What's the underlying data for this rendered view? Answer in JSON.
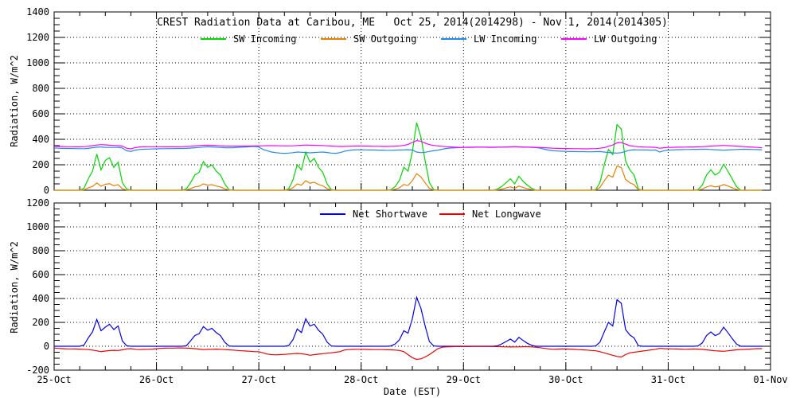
{
  "title": "CREST Radiation Data at Caribou, ME   Oct 25, 2014(2014298) - Nov 1, 2014(2014305)",
  "xlabel": "Date (EST)",
  "x_day_labels": [
    "25-Oct",
    "26-Oct",
    "27-Oct",
    "28-Oct",
    "29-Oct",
    "30-Oct",
    "31-Oct",
    "01-Nov"
  ],
  "chart_data": [
    {
      "type": "line",
      "title": "CREST Radiation Data at Caribou, ME   Oct 25, 2014(2014298) - Nov 1, 2014(2014305)",
      "ylabel": "Radiation, W/m^2",
      "xlabel": "Date (EST)",
      "ylim": [
        0,
        1400
      ],
      "ytick_step": 200,
      "ytick_minor_step": 50,
      "x_minor_step_hours": 6,
      "grid": true,
      "legend_position": "top-inside",
      "x_unit": "hours since Oct 25 00:00 EST, one value per hour",
      "series": [
        {
          "name": "SW Incoming",
          "color": "#00d800",
          "values": [
            0,
            0,
            0,
            0,
            0,
            0,
            0,
            15,
            90,
            150,
            285,
            160,
            235,
            255,
            180,
            220,
            60,
            10,
            0,
            0,
            0,
            0,
            0,
            0,
            0,
            0,
            0,
            0,
            0,
            0,
            0,
            10,
            60,
            120,
            140,
            225,
            180,
            200,
            150,
            120,
            50,
            5,
            0,
            0,
            0,
            0,
            0,
            0,
            0,
            0,
            0,
            0,
            0,
            0,
            0,
            10,
            80,
            200,
            160,
            300,
            220,
            250,
            180,
            140,
            50,
            5,
            0,
            0,
            0,
            0,
            0,
            0,
            0,
            0,
            0,
            0,
            0,
            0,
            0,
            5,
            30,
            80,
            180,
            150,
            300,
            530,
            420,
            230,
            60,
            5,
            0,
            0,
            0,
            0,
            0,
            0,
            0,
            0,
            0,
            0,
            0,
            0,
            0,
            0,
            10,
            30,
            60,
            90,
            50,
            110,
            70,
            40,
            15,
            0,
            0,
            0,
            0,
            0,
            0,
            0,
            0,
            0,
            0,
            0,
            0,
            0,
            0,
            5,
            60,
            200,
            320,
            280,
            515,
            480,
            230,
            160,
            120,
            10,
            0,
            0,
            0,
            0,
            0,
            0,
            0,
            0,
            0,
            0,
            0,
            0,
            0,
            5,
            40,
            120,
            160,
            120,
            140,
            205,
            150,
            90,
            30,
            0,
            0,
            0,
            0,
            0,
            0
          ]
        },
        {
          "name": "SW Outgoing",
          "color": "#e88000",
          "values": [
            0,
            0,
            0,
            0,
            0,
            0,
            0,
            3,
            18,
            30,
            57,
            32,
            47,
            51,
            36,
            44,
            12,
            2,
            0,
            0,
            0,
            0,
            0,
            0,
            0,
            0,
            0,
            0,
            0,
            0,
            0,
            2,
            13,
            26,
            31,
            50,
            40,
            44,
            33,
            26,
            11,
            1,
            0,
            0,
            0,
            0,
            0,
            0,
            0,
            0,
            0,
            0,
            0,
            0,
            0,
            3,
            20,
            50,
            40,
            75,
            55,
            63,
            45,
            35,
            13,
            1,
            0,
            0,
            0,
            0,
            0,
            0,
            0,
            0,
            0,
            0,
            0,
            0,
            0,
            1,
            8,
            20,
            45,
            38,
            75,
            130,
            105,
            58,
            15,
            1,
            0,
            0,
            0,
            0,
            0,
            0,
            0,
            0,
            0,
            0,
            0,
            0,
            0,
            0,
            3,
            9,
            18,
            27,
            15,
            33,
            21,
            12,
            5,
            0,
            0,
            0,
            0,
            0,
            0,
            0,
            0,
            0,
            0,
            0,
            0,
            0,
            0,
            2,
            22,
            74,
            118,
            104,
            190,
            178,
            85,
            59,
            44,
            4,
            0,
            0,
            0,
            0,
            0,
            0,
            0,
            0,
            0,
            0,
            0,
            0,
            0,
            1,
            9,
            26,
            35,
            26,
            31,
            45,
            33,
            20,
            7,
            0,
            0,
            0,
            0,
            0,
            0
          ]
        },
        {
          "name": "LW Incoming",
          "color": "#1e8cec",
          "values": [
            332,
            330,
            329,
            328,
            328,
            327,
            326,
            326,
            329,
            334,
            338,
            340,
            337,
            336,
            336,
            337,
            332,
            310,
            305,
            315,
            320,
            322,
            323,
            324,
            325,
            326,
            326,
            327,
            327,
            328,
            328,
            329,
            331,
            334,
            337,
            339,
            341,
            340,
            338,
            336,
            334,
            333,
            334,
            336,
            338,
            340,
            342,
            344,
            340,
            320,
            310,
            300,
            295,
            292,
            290,
            292,
            295,
            300,
            298,
            296,
            294,
            296,
            298,
            300,
            296,
            292,
            290,
            295,
            305,
            312,
            316,
            318,
            318,
            317,
            316,
            316,
            315,
            315,
            314,
            314,
            315,
            316,
            317,
            318,
            316,
            300,
            295,
            298,
            305,
            310,
            315,
            322,
            328,
            332,
            334,
            335,
            336,
            337,
            337,
            338,
            338,
            338,
            337,
            337,
            338,
            338,
            339,
            340,
            341,
            341,
            340,
            339,
            337,
            335,
            330,
            322,
            315,
            310,
            308,
            306,
            305,
            304,
            304,
            303,
            303,
            302,
            302,
            303,
            304,
            300,
            296,
            294,
            292,
            295,
            305,
            315,
            318,
            317,
            316,
            316,
            315,
            316,
            300,
            310,
            315,
            317,
            318,
            319,
            320,
            320,
            321,
            321,
            322,
            322,
            320,
            318,
            316,
            315,
            316,
            318,
            320,
            321,
            322,
            321,
            320,
            319,
            318
          ]
        },
        {
          "name": "LW Outgoing",
          "color": "#ff00ff",
          "values": [
            345,
            344,
            343,
            342,
            342,
            341,
            341,
            342,
            345,
            350,
            355,
            358,
            356,
            354,
            352,
            350,
            346,
            330,
            325,
            335,
            340,
            341,
            342,
            342,
            342,
            342,
            341,
            341,
            341,
            341,
            342,
            343,
            345,
            348,
            351,
            353,
            354,
            353,
            351,
            349,
            347,
            346,
            346,
            346,
            346,
            346,
            347,
            348,
            348,
            349,
            350,
            350,
            350,
            349,
            348,
            348,
            349,
            351,
            353,
            355,
            354,
            353,
            352,
            351,
            349,
            347,
            345,
            344,
            344,
            345,
            346,
            347,
            347,
            346,
            346,
            345,
            345,
            344,
            344,
            345,
            346,
            348,
            352,
            360,
            375,
            390,
            385,
            370,
            358,
            352,
            348,
            345,
            342,
            340,
            338,
            337,
            337,
            338,
            338,
            338,
            338,
            338,
            338,
            338,
            338,
            339,
            340,
            341,
            341,
            340,
            339,
            338,
            338,
            337,
            336,
            334,
            332,
            330,
            329,
            328,
            328,
            327,
            326,
            326,
            325,
            325,
            326,
            327,
            330,
            335,
            345,
            355,
            372,
            375,
            362,
            350,
            345,
            342,
            340,
            339,
            338,
            337,
            330,
            334,
            336,
            337,
            338,
            338,
            339,
            340,
            340,
            341,
            342,
            344,
            346,
            348,
            350,
            352,
            350,
            348,
            346,
            344,
            342,
            340,
            338,
            336,
            334
          ]
        }
      ]
    },
    {
      "type": "line",
      "ylabel": "Radiation, W/m^2",
      "xlabel": "Date (EST)",
      "ylim": [
        -200,
        1200
      ],
      "ytick_step": 200,
      "ytick_minor_step": 50,
      "x_minor_step_hours": 6,
      "grid": true,
      "legend_position": "top-inside",
      "x_unit": "hours since Oct 25 00:00 EST, one value per hour",
      "series": [
        {
          "name": "Net Shortwave",
          "color": "#0000ee",
          "values": [
            0,
            0,
            0,
            0,
            0,
            0,
            0,
            10,
            70,
            120,
            225,
            130,
            160,
            185,
            140,
            170,
            45,
            5,
            0,
            0,
            0,
            0,
            0,
            0,
            0,
            0,
            0,
            0,
            0,
            0,
            0,
            5,
            45,
            90,
            105,
            165,
            135,
            150,
            115,
            90,
            35,
            3,
            0,
            0,
            0,
            0,
            0,
            0,
            0,
            0,
            0,
            0,
            0,
            0,
            0,
            6,
            55,
            145,
            115,
            230,
            170,
            185,
            135,
            100,
            35,
            3,
            0,
            0,
            0,
            0,
            0,
            0,
            0,
            0,
            0,
            0,
            0,
            0,
            0,
            3,
            20,
            55,
            130,
            110,
            230,
            410,
            320,
            170,
            40,
            3,
            0,
            0,
            0,
            0,
            0,
            0,
            0,
            0,
            0,
            0,
            0,
            0,
            0,
            0,
            5,
            20,
            40,
            60,
            35,
            75,
            48,
            25,
            8,
            0,
            0,
            0,
            0,
            0,
            0,
            0,
            0,
            0,
            0,
            0,
            0,
            0,
            0,
            3,
            35,
            120,
            200,
            170,
            390,
            360,
            140,
            95,
            70,
            5,
            0,
            0,
            0,
            0,
            0,
            0,
            0,
            0,
            0,
            0,
            0,
            0,
            0,
            3,
            28,
            90,
            120,
            90,
            105,
            160,
            115,
            65,
            20,
            0,
            0,
            0,
            0,
            0,
            0
          ]
        },
        {
          "name": "Net Longwave",
          "color": "#ee0000",
          "values": [
            -15,
            -18,
            -20,
            -22,
            -22,
            -23,
            -24,
            -25,
            -28,
            -32,
            -38,
            -45,
            -40,
            -36,
            -34,
            -35,
            -30,
            -22,
            -20,
            -25,
            -28,
            -26,
            -25,
            -24,
            -20,
            -18,
            -16,
            -15,
            -15,
            -14,
            -14,
            -15,
            -17,
            -20,
            -24,
            -28,
            -26,
            -25,
            -24,
            -25,
            -28,
            -30,
            -32,
            -35,
            -38,
            -40,
            -42,
            -45,
            -45,
            -55,
            -65,
            -70,
            -72,
            -70,
            -68,
            -65,
            -62,
            -60,
            -62,
            -68,
            -75,
            -70,
            -66,
            -62,
            -58,
            -55,
            -50,
            -45,
            -32,
            -28,
            -26,
            -25,
            -25,
            -26,
            -27,
            -28,
            -28,
            -28,
            -29,
            -30,
            -32,
            -35,
            -45,
            -70,
            -95,
            -110,
            -105,
            -90,
            -70,
            -45,
            -20,
            -8,
            -5,
            -4,
            -3,
            -3,
            -3,
            -3,
            -2,
            -2,
            -2,
            -2,
            -2,
            -3,
            -3,
            -4,
            -5,
            -6,
            -5,
            -5,
            -4,
            -4,
            -5,
            -8,
            -12,
            -18,
            -22,
            -25,
            -24,
            -23,
            -23,
            -24,
            -26,
            -28,
            -30,
            -32,
            -35,
            -38,
            -45,
            -55,
            -65,
            -75,
            -85,
            -90,
            -70,
            -55,
            -50,
            -45,
            -40,
            -35,
            -30,
            -25,
            -18,
            -20,
            -21,
            -22,
            -23,
            -24,
            -25,
            -24,
            -23,
            -24,
            -26,
            -30,
            -34,
            -38,
            -40,
            -42,
            -38,
            -34,
            -30,
            -28,
            -26,
            -24,
            -22,
            -20,
            -20
          ]
        }
      ]
    }
  ]
}
